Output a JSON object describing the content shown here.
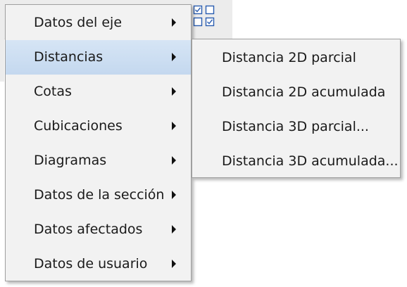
{
  "main_menu": {
    "items": [
      {
        "label": "Datos del eje"
      },
      {
        "label": "Distancias"
      },
      {
        "label": "Cotas"
      },
      {
        "label": "Cubicaciones"
      },
      {
        "label": "Diagramas"
      },
      {
        "label": "Datos de la sección"
      },
      {
        "label": "Datos afectados"
      },
      {
        "label": "Datos de usuario"
      }
    ],
    "highlighted_index": 1
  },
  "sub_menu": {
    "parent_label": "Distancias",
    "items": [
      {
        "label": "Distancia 2D parcial"
      },
      {
        "label": "Distancia 2D acumulada"
      },
      {
        "label": "Distancia 3D parcial..."
      },
      {
        "label": "Distancia 3D acumulada..."
      }
    ]
  },
  "toolbar": {
    "icon_name": "checkbox-grid-icon",
    "icon_color": "#2a5db0"
  },
  "colors": {
    "menu_background": "#f2f2f2",
    "highlight": "#cfe0f3",
    "text": "#1a1a1a"
  }
}
